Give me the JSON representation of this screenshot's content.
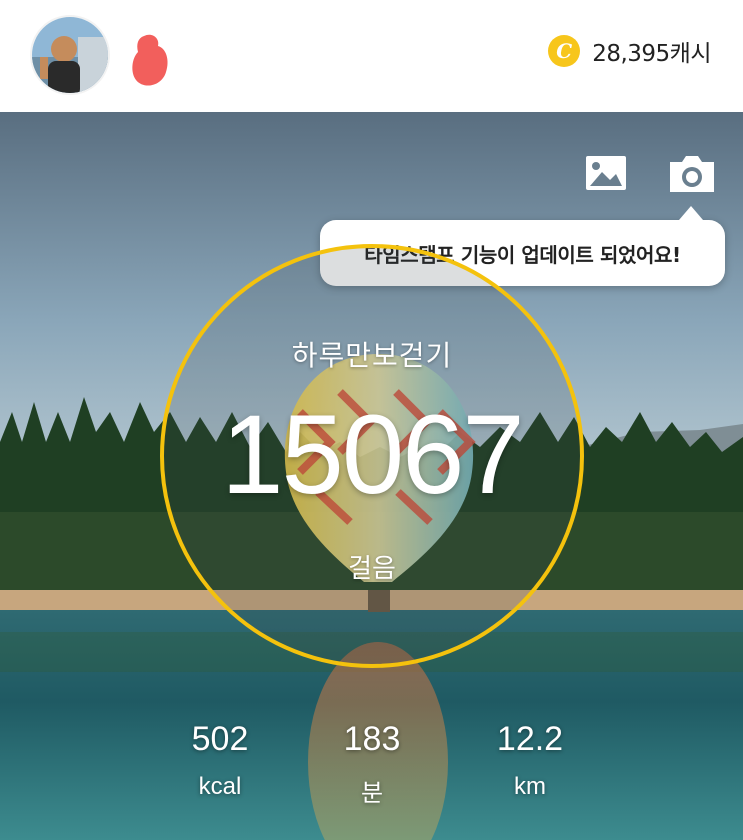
{
  "header": {
    "cash_amount": "28,395캐시",
    "coin_symbol": "C"
  },
  "hero": {
    "tooltip_text": "타임스탬프 기능이 업데이트 되었어요!",
    "title": "하루만보걷기",
    "steps": "15067",
    "steps_unit": "걸음"
  },
  "stats": {
    "calories": {
      "value": "502",
      "unit": "kcal"
    },
    "minutes": {
      "value": "183",
      "unit": "분"
    },
    "distance": {
      "value": "12.2",
      "unit": "km"
    }
  },
  "colors": {
    "accent_ring": "#f4c20d",
    "coin": "#f7c61b",
    "redaction": "#f25f5c"
  },
  "icons": [
    "avatar",
    "coin-icon",
    "gallery-icon",
    "camera-icon"
  ]
}
